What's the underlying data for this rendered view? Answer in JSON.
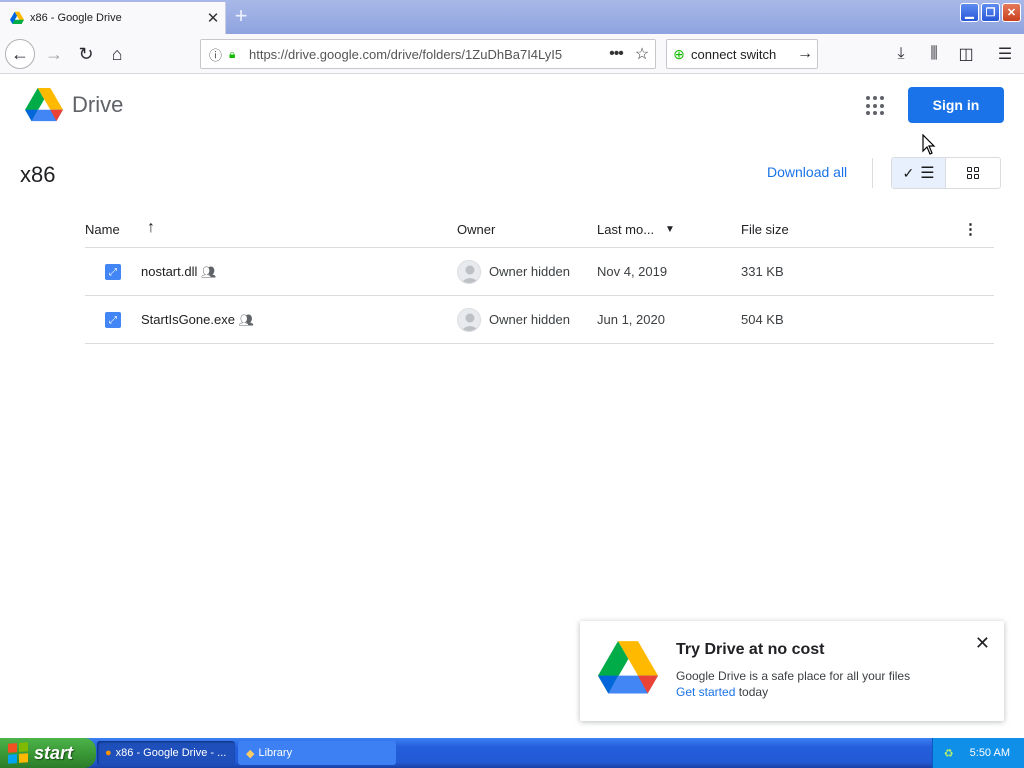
{
  "browser": {
    "tab_title": "x86 - Google Drive",
    "url": "https://drive.google.com/drive/folders/1ZuDhBa7I4LyI5",
    "extension_label": "connect switch"
  },
  "drive": {
    "app_name": "Drive",
    "sign_in_label": "Sign in",
    "folder_title": "x86",
    "download_all_label": "Download all"
  },
  "table": {
    "headers": {
      "name": "Name",
      "owner": "Owner",
      "last_modified": "Last mo...",
      "file_size": "File size"
    },
    "rows": [
      {
        "name": "nostart.dll",
        "owner": "Owner hidden",
        "modified": "Nov 4, 2019",
        "size": "331 KB"
      },
      {
        "name": "StartIsGone.exe",
        "owner": "Owner hidden",
        "modified": "Jun 1, 2020",
        "size": "504 KB"
      }
    ]
  },
  "promo": {
    "title": "Try Drive at no cost",
    "text": "Google Drive is a safe place for all your files",
    "link_label": "Get started",
    "link_suffix": " today"
  },
  "taskbar": {
    "start_label": "start",
    "tasks": [
      "x86 - Google Drive - ...",
      "Library"
    ],
    "clock": "5:50 AM"
  },
  "colors": {
    "drive_blue": "#1a73e8",
    "taskbar_blue": "#245edb",
    "start_green": "#379433"
  }
}
